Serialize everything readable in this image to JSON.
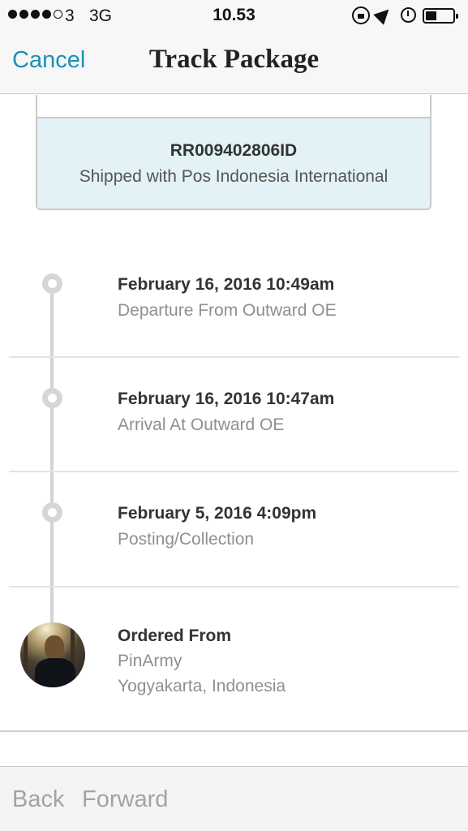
{
  "status_bar": {
    "carrier": "3",
    "network": "3G",
    "time": "10.53",
    "signal_bars_filled": 4,
    "signal_bars_total": 5,
    "battery_level": 0.4,
    "icons": [
      "orientation-lock-icon",
      "location-icon",
      "alarm-icon",
      "battery-icon"
    ]
  },
  "nav": {
    "cancel_label": "Cancel",
    "title": "Track Package"
  },
  "package": {
    "tracking_number": "RR009402806ID",
    "carrier_text": "Shipped with Pos Indonesia International"
  },
  "events": [
    {
      "date": "February 16, 2016 10:49am",
      "description": "Departure From Outward OE"
    },
    {
      "date": "February 16, 2016 10:47am",
      "description": "Arrival At Outward OE"
    },
    {
      "date": "February 5, 2016 4:09pm",
      "description": "Posting/Collection"
    }
  ],
  "origin": {
    "title": "Ordered From",
    "seller": "PinArmy",
    "location": "Yogyakarta, Indonesia"
  },
  "toolbar": {
    "back_label": "Back",
    "forward_label": "Forward"
  },
  "colors": {
    "accent": "#1e8fb8",
    "card_highlight": "#e2f2f7",
    "timeline": "#d4d4d4",
    "disabled_text": "#a3a3a3"
  }
}
